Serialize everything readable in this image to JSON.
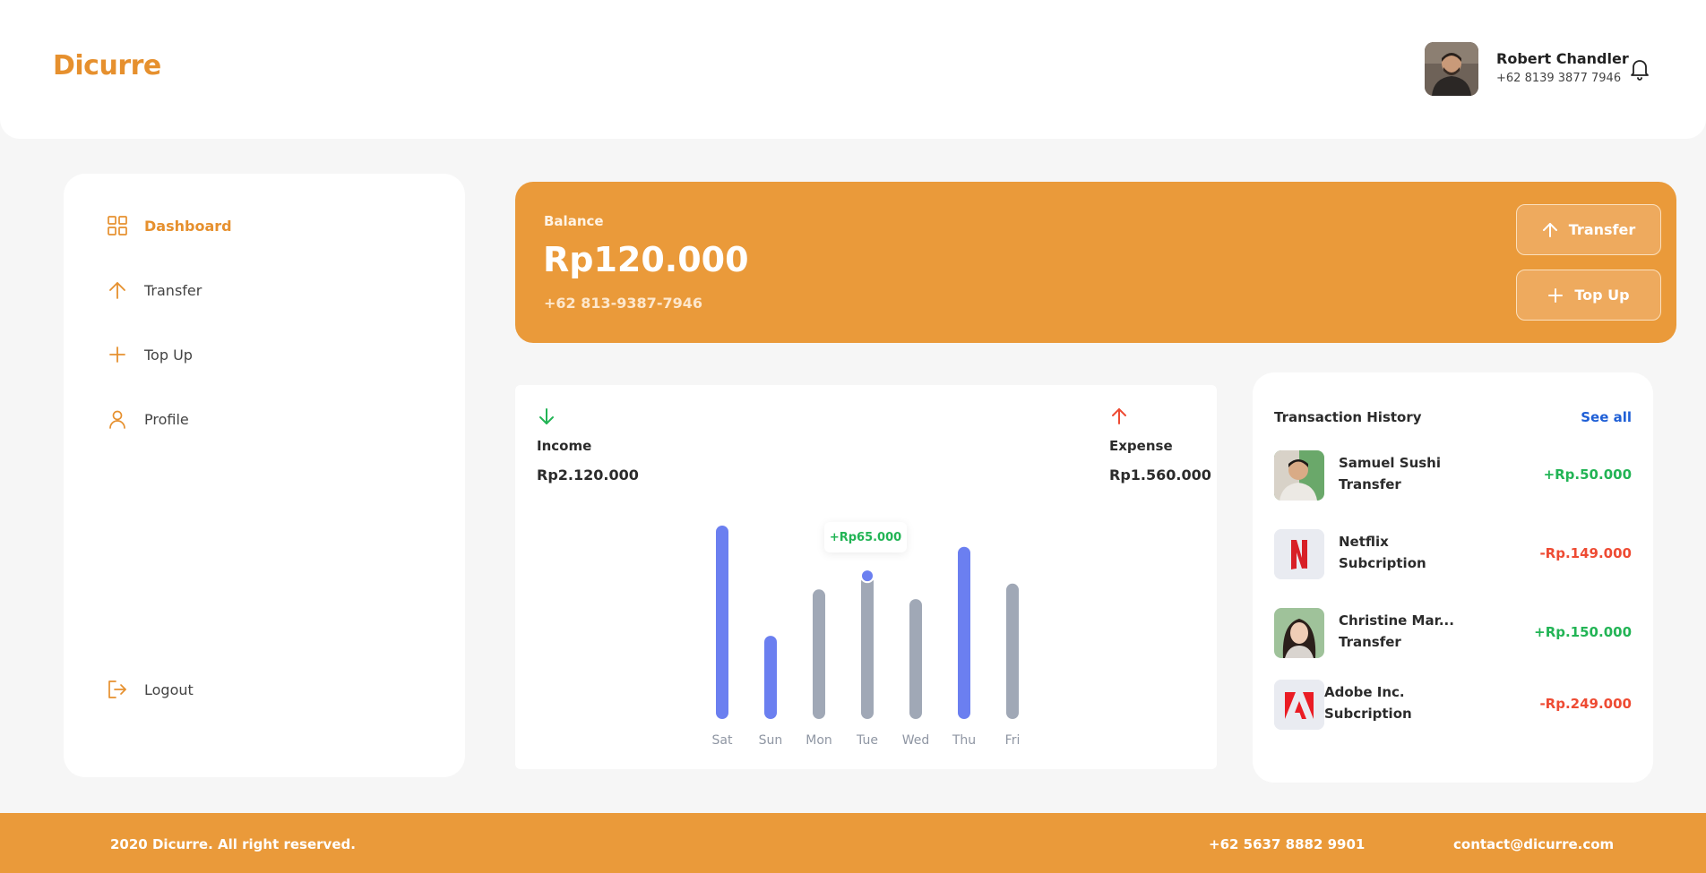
{
  "app": {
    "logo": "Dicurre"
  },
  "user": {
    "name": "Robert Chandler",
    "phone": "+62 8139 3877 7946",
    "avatar_icon": "user-avatar-photo"
  },
  "sidebar": {
    "items": [
      {
        "label": "Dashboard",
        "icon": "grid-icon",
        "active": true
      },
      {
        "label": "Transfer",
        "icon": "arrow-up-icon",
        "active": false
      },
      {
        "label": "Top Up",
        "icon": "plus-icon",
        "active": false
      },
      {
        "label": "Profile",
        "icon": "user-icon",
        "active": false
      }
    ],
    "logout_label": "Logout"
  },
  "balance": {
    "label": "Balance",
    "amount": "Rp120.000",
    "phone": "+62 813-9387-7946",
    "transfer_label": "Transfer",
    "topup_label": "Top Up"
  },
  "stats": {
    "income_label": "Income",
    "income_value": "Rp2.120.000",
    "expense_label": "Expense",
    "expense_value": "Rp1.560.000"
  },
  "chart_data": {
    "type": "bar",
    "categories": [
      "Sat",
      "Sun",
      "Mon",
      "Tue",
      "Wed",
      "Thu",
      "Fri"
    ],
    "values": [
      100,
      43,
      67,
      74,
      62,
      89,
      70
    ],
    "highlighted": [
      true,
      true,
      false,
      false,
      false,
      true,
      false
    ],
    "tooltip": {
      "category": "Tue",
      "text": "+Rp65.000"
    },
    "colors": {
      "highlight": "#6b7ff0",
      "normal": "#a0a8b6",
      "point": "#6b7ff0"
    },
    "ylim": [
      0,
      100
    ]
  },
  "history": {
    "title": "Transaction History",
    "see_all": "See all",
    "items": [
      {
        "name": "Samuel Sushi",
        "type": "Transfer",
        "amount": "+Rp.50.000",
        "positive": true,
        "icon": "person-photo"
      },
      {
        "name": "Netflix",
        "type": "Subcription",
        "amount": "-Rp.149.000",
        "positive": false,
        "icon": "netflix-logo-icon"
      },
      {
        "name": "Christine Mar...",
        "type": "Transfer",
        "amount": "+Rp.150.000",
        "positive": true,
        "icon": "person-photo"
      },
      {
        "name": "Adobe Inc.",
        "type": "Subcription",
        "amount": "-Rp.249.000",
        "positive": false,
        "icon": "adobe-logo-icon"
      }
    ]
  },
  "footer": {
    "copyright": "2020 Dicurre. All right reserved.",
    "phone": "+62 5637 8882 9901",
    "email": "contact@dicurre.com"
  },
  "colors": {
    "brand": "#ea9a3a",
    "positive": "#22b455",
    "negative": "#ee4b33",
    "link": "#1f5fd6"
  }
}
